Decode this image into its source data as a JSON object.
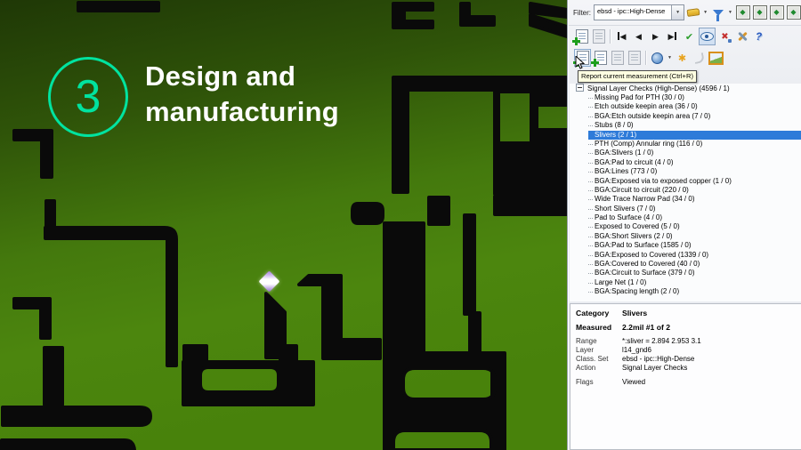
{
  "overlay": {
    "step_number": "3",
    "title": "Design and manufacturing",
    "accent_color": "#00e3a0"
  },
  "pcb_view": {
    "description": "PCB copper layer view with black traces on green background",
    "marker": "sliver-measurement-highlight",
    "colors": {
      "board_green_light": "#4c860e",
      "board_green_dark": "#243f07",
      "trace_black": "#0a0a0a",
      "marker_violet": "#9b6fd8"
    }
  },
  "filter_bar": {
    "label": "Filter:",
    "value": "ebsd - ipc::High-Dense"
  },
  "toolbar": {
    "row1_icons": [
      "highlighter-icon",
      "dropdown-arrow",
      "filter-funnel-icon",
      "dropdown-arrow",
      "zoom-measurement-icon",
      "zoom-measurement-icon",
      "zoom-prev-measurement-icon",
      "zoom-next-measurement-icon"
    ],
    "row2_icons": [
      "add-table-icon",
      "table-icon",
      "first-measurement-icon",
      "previous-measurement-icon",
      "next-measurement-icon",
      "last-measurement-icon",
      "approve-check-icon",
      "view-eye-icon",
      "reject-x-icon",
      "tools-icon",
      "help-icon"
    ],
    "row3_icons": [
      "report-current-measurement-icon",
      "report-add-icon",
      "report-disabled-icon",
      "report-disabled-icon",
      "color-picker-icon",
      "dropdown-arrow",
      "settings-sun-icon",
      "history-icon",
      "snapshot-icon"
    ]
  },
  "icons": {
    "dropdown_glyph": "▼",
    "first_glyph": "◀",
    "prev_glyph": "◀",
    "next_glyph": "▶",
    "last_glyph": "▶",
    "check_glyph": "✔",
    "close_glyph": "✖",
    "help_glyph": "?",
    "settings_glyph": "✱",
    "diamond_glyph": "◆"
  },
  "tooltip": {
    "text": "Report current measurement (Ctrl+R)"
  },
  "tree": {
    "root_label": "Signal Layer Checks (High-Dense) (4596 / 1)",
    "items": [
      {
        "label": "Missing Pad for PTH (30 / 0)"
      },
      {
        "label": "Etch outside keepin area (36 / 0)"
      },
      {
        "label": "BGA:Etch outside keepin area (7 / 0)"
      },
      {
        "label": "Stubs (8 / 0)"
      },
      {
        "label": "Slivers (2 / 1)",
        "selected": true
      },
      {
        "label": "PTH (Comp) Annular ring (116 / 0)"
      },
      {
        "label": "BGA:Slivers (1 / 0)"
      },
      {
        "label": "BGA:Pad to circuit (4 / 0)"
      },
      {
        "label": "BGA:Lines (773 / 0)"
      },
      {
        "label": "BGA:Exposed via to exposed copper (1 / 0)"
      },
      {
        "label": "BGA:Circuit to circuit (220 / 0)"
      },
      {
        "label": "Wide Trace Narrow Pad (34 / 0)"
      },
      {
        "label": "Short Slivers (7 / 0)"
      },
      {
        "label": "Pad to Surface (4 / 0)"
      },
      {
        "label": "Exposed to Covered (5 / 0)"
      },
      {
        "label": "BGA:Short Slivers (2 / 0)"
      },
      {
        "label": "BGA:Pad to Surface (1585 / 0)"
      },
      {
        "label": "BGA:Exposed to Covered (1339 / 0)"
      },
      {
        "label": "BGA:Covered to Covered (40 / 0)"
      },
      {
        "label": "BGA:Circuit to Surface (379 / 0)"
      },
      {
        "label": "Large Net (1 / 0)"
      },
      {
        "label": "BGA:Spacing length (2 / 0)"
      }
    ]
  },
  "details": {
    "rows": [
      {
        "label": "Category",
        "value": "Slivers",
        "bold": true
      },
      {
        "label": "Measured",
        "value": "2.2mil #1 of 2",
        "bold": true,
        "gap": true
      },
      {
        "label": "Range",
        "value": "*:sliver = 2.894 2.953 3.1",
        "gap": true
      },
      {
        "label": "Layer",
        "value": "l14_gnd6"
      },
      {
        "label": "Class. Set",
        "value": "ebsd - ipc::High-Dense"
      },
      {
        "label": "Action",
        "value": "Signal Layer Checks"
      },
      {
        "label": "Flags",
        "value": "Viewed",
        "gap": true
      }
    ]
  },
  "selection_color": "#2e7bd9",
  "tooltip_bg": "#ffffe1"
}
